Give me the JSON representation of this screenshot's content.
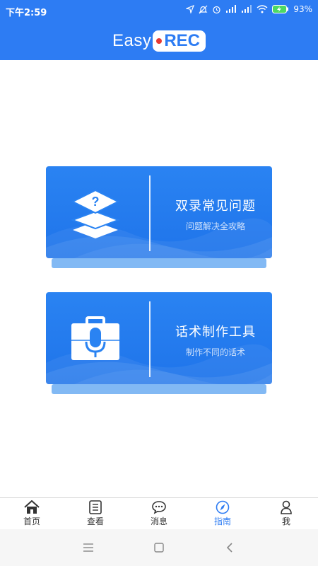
{
  "status": {
    "time": "下午2:59",
    "battery": "93%"
  },
  "header": {
    "logo_left": "Easy",
    "logo_right": "REC"
  },
  "cards": [
    {
      "title": "双录常见问题",
      "subtitle": "问题解决全攻略",
      "icon": "question-layers-icon"
    },
    {
      "title": "话术制作工具",
      "subtitle": "制作不同的话术",
      "icon": "microphone-briefcase-icon"
    }
  ],
  "tabs": [
    {
      "label": "首页",
      "icon": "home-icon",
      "active": false
    },
    {
      "label": "查看",
      "icon": "document-icon",
      "active": false
    },
    {
      "label": "消息",
      "icon": "chat-icon",
      "active": false
    },
    {
      "label": "指南",
      "icon": "compass-icon",
      "active": true
    },
    {
      "label": "我",
      "icon": "person-icon",
      "active": false
    }
  ],
  "colors": {
    "primary": "#2d7cf3",
    "card": "#2a83f2",
    "tab_text": "#333333"
  }
}
